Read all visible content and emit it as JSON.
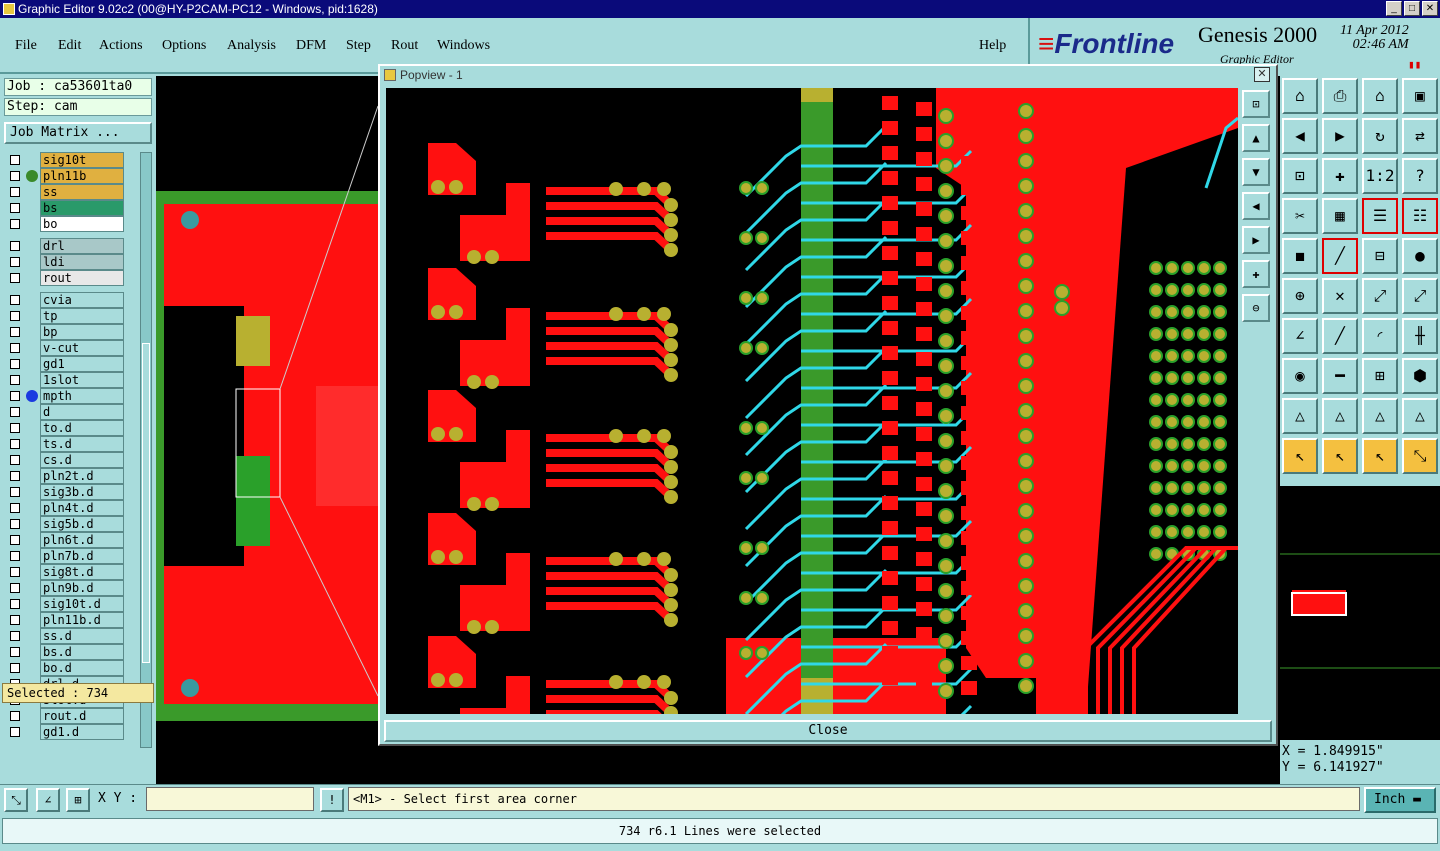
{
  "window": {
    "title": "Graphic Editor 9.02c2 (00@HY-P2CAM-PC12 - Windows, pid:1628)"
  },
  "menu": [
    {
      "label": "File"
    },
    {
      "label": "Edit"
    },
    {
      "label": "Actions"
    },
    {
      "label": "Options"
    },
    {
      "label": "Analysis"
    },
    {
      "label": "DFM"
    },
    {
      "label": "Step"
    },
    {
      "label": "Rout"
    },
    {
      "label": "Windows"
    },
    {
      "label": "Help"
    }
  ],
  "brand": {
    "logo": "Frontline",
    "product": "Genesis 2000",
    "subtitle": "Graphic Editor",
    "date": "11 Apr 2012",
    "time": "02:46 AM"
  },
  "job": {
    "job": "Job : ca53601ta0",
    "step": "Step: cam",
    "matrix_label": "Job Matrix ..."
  },
  "layers": [
    {
      "name": "sig10t",
      "color": "#e0b040"
    },
    {
      "name": "pln11b",
      "color": "#e0b040",
      "dot": "#3a8a2a"
    },
    {
      "name": "ss",
      "color": "#e0b040",
      "active": true
    },
    {
      "name": "bs",
      "color": "#2a9a6a"
    },
    {
      "name": "bo",
      "color": "#ffffff"
    },
    {
      "name": "drl",
      "color": "#a8c8c8"
    },
    {
      "name": "ldi",
      "color": "#a8c8c8"
    },
    {
      "name": "rout",
      "color": "#e8e8e8"
    },
    {
      "name": "cvia"
    },
    {
      "name": "tp"
    },
    {
      "name": "bp"
    },
    {
      "name": "v-cut"
    },
    {
      "name": "gd1"
    },
    {
      "name": "1slot"
    },
    {
      "name": "mpth",
      "dot": "#1a3ae0"
    },
    {
      "name": "d"
    },
    {
      "name": "to.d"
    },
    {
      "name": "ts.d"
    },
    {
      "name": "cs.d"
    },
    {
      "name": "pln2t.d"
    },
    {
      "name": "sig3b.d"
    },
    {
      "name": "pln4t.d"
    },
    {
      "name": "sig5b.d"
    },
    {
      "name": "pln6t.d"
    },
    {
      "name": "pln7b.d"
    },
    {
      "name": "sig8t.d"
    },
    {
      "name": "pln9b.d"
    },
    {
      "name": "sig10t.d"
    },
    {
      "name": "pln11b.d"
    },
    {
      "name": "ss.d"
    },
    {
      "name": "bs.d"
    },
    {
      "name": "bo.d"
    },
    {
      "name": "drl.d"
    },
    {
      "name": "slot.d"
    },
    {
      "name": "rout.d"
    },
    {
      "name": "gd1.d"
    }
  ],
  "selected": "Selected : 734",
  "popview": {
    "title": "Popview - 1",
    "close_label": "Close",
    "close_x": "✕"
  },
  "coords": {
    "x": "X = 1.849915\"",
    "y": "Y = 6.141927\""
  },
  "bottom": {
    "xy_label": "X Y :",
    "xy_value": "",
    "prompt": "<M1> - Select first area corner",
    "unit": "Inch"
  },
  "status": "734 r6.1 Lines were selected",
  "colors": {
    "copper": "#ff1010",
    "pad": "#b8b030",
    "pad_ring": "#2aa02a",
    "trace": "#30d8e8",
    "board_edge": "#3a9a2a",
    "background": "#000000"
  }
}
